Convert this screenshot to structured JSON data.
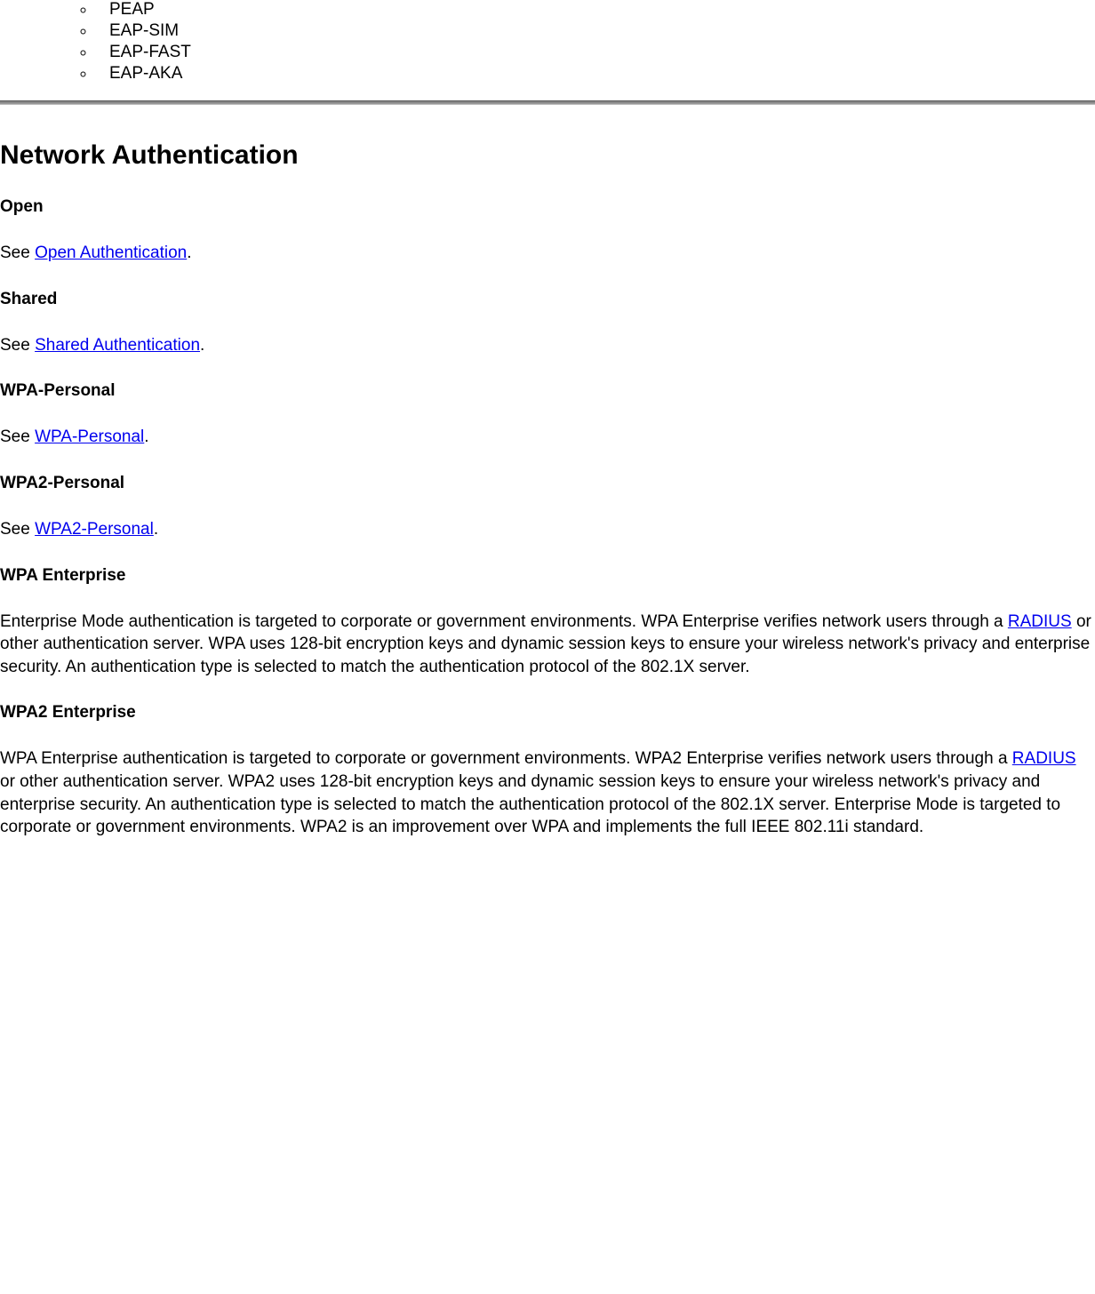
{
  "sublist": {
    "items": [
      "PEAP",
      "EAP-SIM",
      "EAP-FAST",
      "EAP-AKA"
    ]
  },
  "heading": "Network Authentication",
  "sections": {
    "open": {
      "title": "Open",
      "see_prefix": "See ",
      "link": "Open Authentication",
      "suffix": "."
    },
    "shared": {
      "title": "Shared",
      "see_prefix": "See ",
      "link": "Shared Authentication",
      "suffix": "."
    },
    "wpa_personal": {
      "title": "WPA-Personal",
      "see_prefix": "See ",
      "link": "WPA-Personal",
      "suffix": "."
    },
    "wpa2_personal": {
      "title": "WPA2-Personal",
      "see_prefix": "See ",
      "link": "WPA2-Personal",
      "suffix": "."
    },
    "wpa_enterprise": {
      "title": "WPA Enterprise",
      "para_before": "Enterprise Mode authentication is targeted to corporate or government environments. WPA Enterprise verifies network users through a ",
      "link": "RADIUS",
      "para_after": " or other authentication server. WPA uses 128-bit encryption keys and dynamic session keys to ensure your wireless network's privacy and enterprise security. An authentication type is selected to match the authentication protocol of the 802.1X server."
    },
    "wpa2_enterprise": {
      "title": "WPA2 Enterprise",
      "para_before": "WPA Enterprise authentication is targeted to corporate or government environments. WPA2 Enterprise verifies network users through a ",
      "link": "RADIUS",
      "para_after": " or other authentication server. WPA2 uses 128-bit encryption keys and dynamic session keys to ensure your wireless network's privacy and enterprise security. An authentication type is selected to match the authentication protocol of the 802.1X server. Enterprise Mode is targeted to corporate or government environments. WPA2 is an improvement over WPA and implements the full IEEE 802.11i standard."
    }
  }
}
